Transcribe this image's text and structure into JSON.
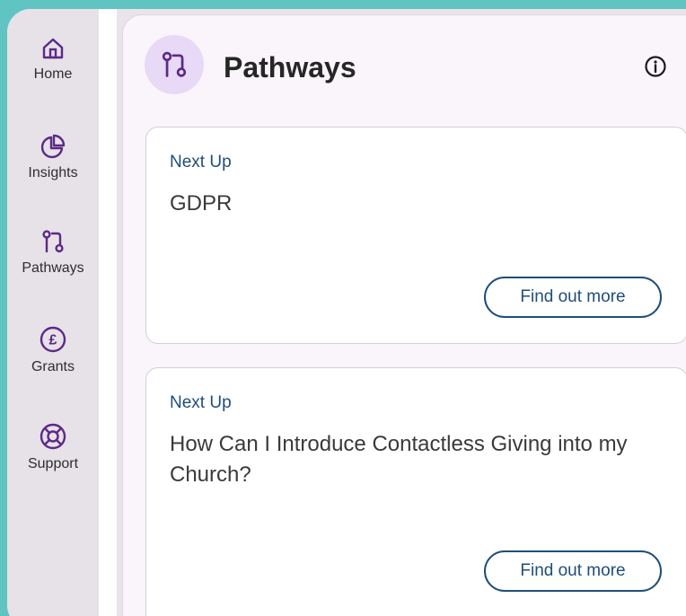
{
  "sidebar": {
    "items": [
      {
        "label": "Home",
        "icon": "home-icon"
      },
      {
        "label": "Insights",
        "icon": "pie-chart-icon"
      },
      {
        "label": "Pathways",
        "icon": "pathways-icon"
      },
      {
        "label": "Grants",
        "icon": "pound-icon"
      },
      {
        "label": "Support",
        "icon": "lifebuoy-icon"
      }
    ]
  },
  "panel": {
    "title": "Pathways",
    "header_icon": "pathways-icon",
    "info_icon": "info-icon"
  },
  "cards": [
    {
      "kicker": "Next Up",
      "title": "GDPR",
      "button_label": "Find out more"
    },
    {
      "kicker": "Next Up",
      "title": "How Can I Introduce Contactless Giving into my Church?",
      "button_label": "Find out more"
    }
  ],
  "colors": {
    "background": "#5fc4c2",
    "sidebar": "#e7e1e8",
    "panel": "#faf5fb",
    "accent": "#1f4e79",
    "icon_purple": "#5b2a86",
    "header_icon_bg": "#e8d9f6"
  }
}
